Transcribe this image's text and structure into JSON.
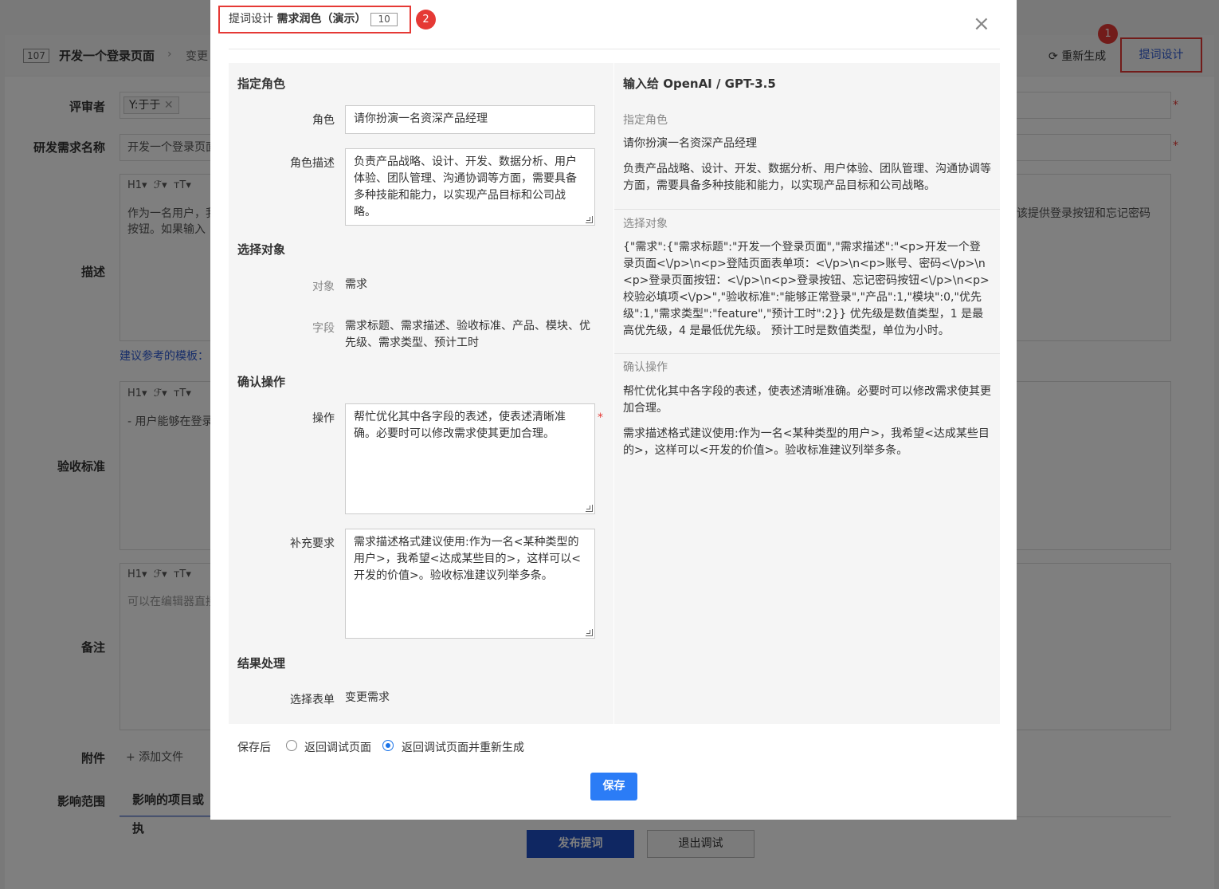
{
  "background": {
    "req_number": "107",
    "req_title": "开发一个登录页面",
    "breadcrumb_sep": "›",
    "breadcrumb_next": "变更",
    "regenerate_label": "重新生成",
    "prompt_design_label": "提词设计",
    "marker1": "1",
    "labels": {
      "reviewer": "评审者",
      "req_name": "研发需求名称",
      "description": "描述",
      "acceptance": "验收标准",
      "remark": "备注",
      "attachment": "附件",
      "impact": "影响范围"
    },
    "reviewer_tag": "Y:于于",
    "req_name_value": "开发一个登录页面",
    "toolbar": {
      "h": "H1▾",
      "f": "ℱ▾",
      "t": "тT▾"
    },
    "description_text_left": "作为一名用户，我",
    "description_text_left2": "按钮。如果输入",
    "description_text_right": "该提供登录按钮和忘记密码",
    "template_link": "建议参考的模板：",
    "acceptance_text": "- 用户能够在登录",
    "remark_placeholder": "可以在编辑器直接",
    "add_file": "+ 添加文件",
    "impact_tab": "影响的项目或执",
    "publish_button": "发布提词",
    "exit_button": "退出调试",
    "required_mark": "*"
  },
  "modal": {
    "title_prefix": "提词设计",
    "title_name": "需求润色（演示）",
    "title_badge": "10",
    "marker2": "2",
    "close_icon": "×",
    "left": {
      "sec_role": "指定角色",
      "role_label": "角色",
      "role_value": "请你扮演一名资深产品经理",
      "role_desc_label": "角色描述",
      "role_desc_value": "负责产品战略、设计、开发、数据分析、用户体验、团队管理、沟通协调等方面，需要具备多种技能和能力，以实现产品目标和公司战略。",
      "sec_object": "选择对象",
      "object_label": "对象",
      "object_value": "需求",
      "fields_label": "字段",
      "fields_value": "需求标题、需求描述、验收标准、产品、模块、优先级、需求类型、预计工时",
      "sec_confirm": "确认操作",
      "op_label": "操作",
      "op_value": "帮忙优化其中各字段的表述，使表述清晰准确。必要时可以修改需求使其更加合理。",
      "op_required": "*",
      "extra_label": "补充要求",
      "extra_value": "需求描述格式建议使用:作为一名<某种类型的用户>，我希望<达成某些目的>，这样可以<开发的价值>。验收标准建议列举多条。",
      "sec_result": "结果处理",
      "form_label": "选择表单",
      "form_value": "变更需求"
    },
    "right": {
      "title": "输入给 OpenAI / GPT-3.5",
      "sec_role": "指定角色",
      "role_value": "请你扮演一名资深产品经理",
      "role_desc_value": "负责产品战略、设计、开发、数据分析、用户体验、团队管理、沟通协调等方面，需要具备多种技能和能力，以实现产品目标和公司战略。",
      "sec_object": "选择对象",
      "object_value": "{\"需求\":{\"需求标题\":\"开发一个登录页面\",\"需求描述\":\"<p>开发一个登录页面<\\/p>\\n<p>登陆页面表单项：<\\/p>\\n<p>账号、密码<\\/p>\\n<p>登录页面按钮：<\\/p>\\n<p>登录按钮、忘记密码按钮<\\/p>\\n<p>校验必填项<\\/p>\",\"验收标准\":\"能够正常登录\",\"产品\":1,\"模块\":0,\"优先级\":1,\"需求类型\":\"feature\",\"预计工时\":2}} 优先级是数值类型，1 是最高优先级，4 是最低优先级。 预计工时是数值类型，单位为小时。",
      "sec_confirm": "确认操作",
      "op_value": "帮忙优化其中各字段的表述，使表述清晰准确。必要时可以修改需求使其更加合理。",
      "extra_value": "需求描述格式建议使用:作为一名<某种类型的用户>，我希望<达成某些目的>，这样可以<开发的价值>。验收标准建议列举多条。"
    },
    "save_after_label": "保存后",
    "radio1_label": "返回调试页面",
    "radio2_label": "返回调试页面并重新生成",
    "radio_selected": "返回调试页面并重新生成",
    "save_button": "保存"
  }
}
